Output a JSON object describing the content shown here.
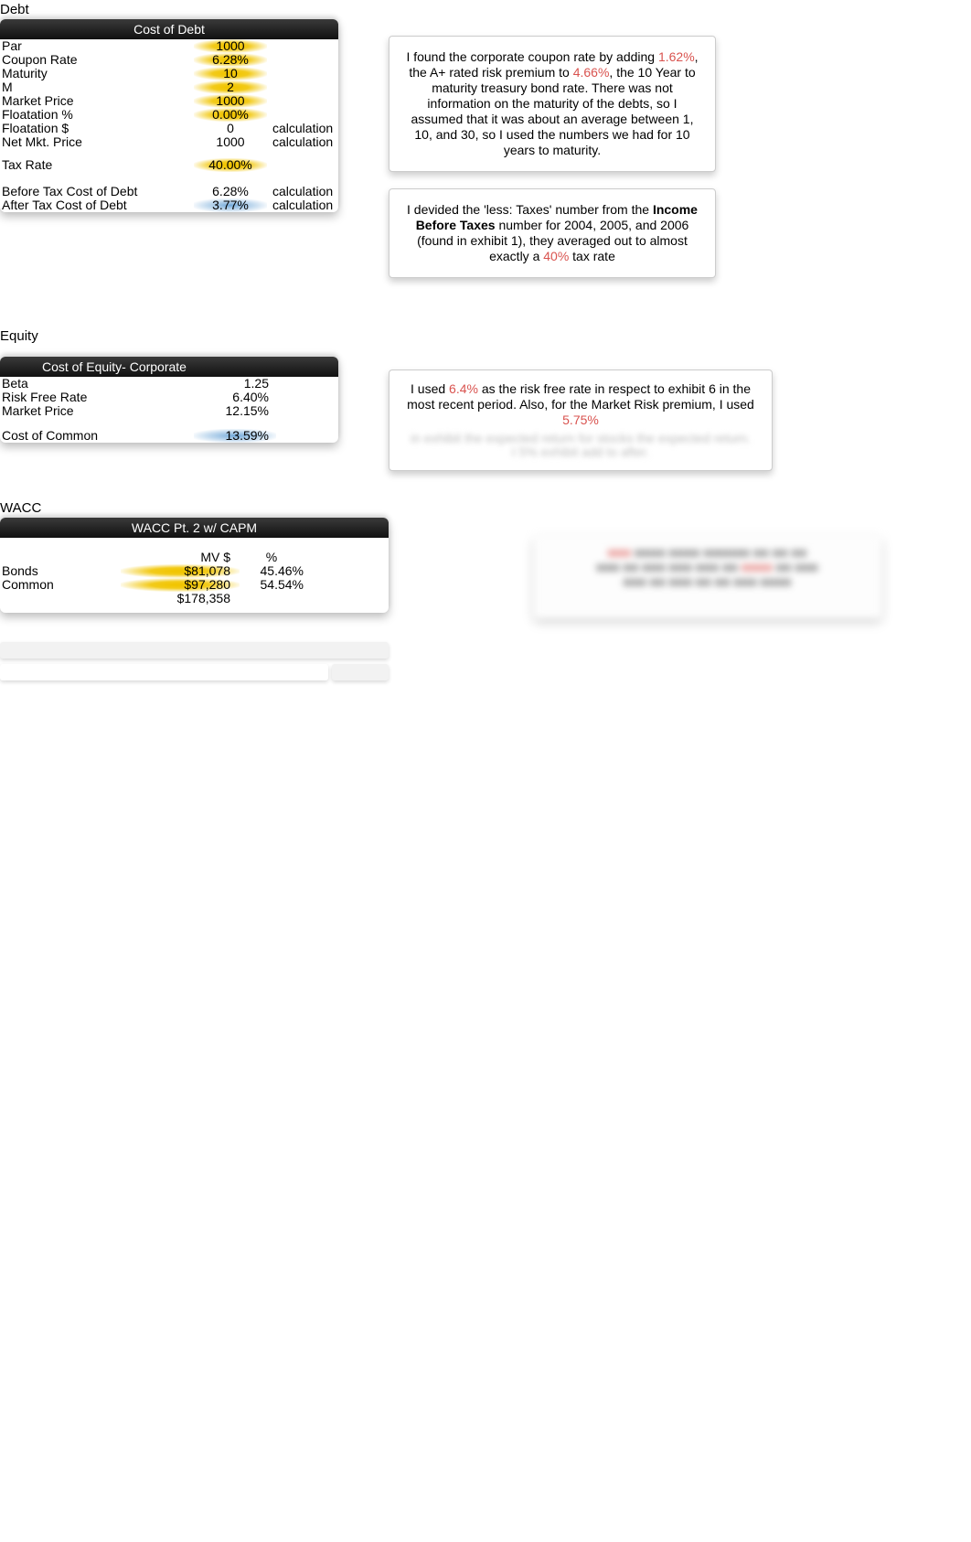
{
  "debt": {
    "section_label": "Debt",
    "title": "Cost of Debt",
    "rows": [
      {
        "label": "Par",
        "value": "1000",
        "note": "",
        "hl": "y"
      },
      {
        "label": "Coupon Rate",
        "value": "6.28%",
        "note": "",
        "hl": "y"
      },
      {
        "label": "Maturity",
        "value": "10",
        "note": "",
        "hl": "y"
      },
      {
        "label": "M",
        "value": "2",
        "note": "",
        "hl": "y"
      },
      {
        "label": "Market Price",
        "value": "1000",
        "note": "",
        "hl": "y"
      },
      {
        "label": "Floatation %",
        "value": "0.00%",
        "note": "",
        "hl": "y"
      },
      {
        "label": "Floatation $",
        "value": "0",
        "note": "calculation",
        "hl": ""
      },
      {
        "label": "Net Mkt. Price",
        "value": "1000",
        "note": "calculation",
        "hl": ""
      }
    ],
    "tax_row": {
      "label": "Tax Rate",
      "value": "40.00%",
      "note": "",
      "hl": "y"
    },
    "result_rows": [
      {
        "label": "Before Tax Cost of Debt",
        "value": "6.28%",
        "note": "calculation",
        "hl": ""
      },
      {
        "label": "After Tax Cost of Debt",
        "value": "3.77%",
        "note": "calculation",
        "hl": "b"
      }
    ],
    "explain1": {
      "p1": "I found the corporate coupon rate by adding ",
      "r1": "1.62%",
      "p2": ", the A+ rated risk premium to ",
      "r2": "4.66%",
      "p3": ", the 10 Year to maturity treasury bond rate. There was not information on the maturity of the debts, so I assumed that it was about an average between 1, 10, and 30, so I used the numbers we had for 10 years to maturity."
    },
    "explain2": {
      "p1": "I devided the 'less: Taxes' number from the ",
      "b1": "Income Before Taxes",
      "p2": " number for 2004, 2005, and 2006 (found in exhibit 1), they averaged out to almost exactly a ",
      "r1": "40%",
      "p3": " tax rate"
    }
  },
  "equity": {
    "section_label": "Equity",
    "title": "Cost of Equity- Corporate",
    "rows": [
      {
        "label": "Beta",
        "value": "1.25"
      },
      {
        "label": "Risk Free Rate",
        "value": "6.40%"
      },
      {
        "label": "Market Price",
        "value": "12.15%"
      }
    ],
    "result_row": {
      "label": "Cost of Common",
      "value": "13.59%",
      "hl": "b"
    },
    "explain": {
      "p1": "I used ",
      "r1": "6.4%",
      "p2": " as the risk free rate in respect to exhibit 6 in the most recent period. Also, for the Market Risk premium, I used ",
      "r2": "5.75%"
    }
  },
  "wacc": {
    "section_label": "WACC",
    "title": "WACC Pt. 2 w/ CAPM",
    "head_mv": "MV $",
    "head_pc": "%",
    "rows": [
      {
        "label": "Bonds",
        "mv": "$81,078",
        "pc": "45.46%",
        "hl": "y"
      },
      {
        "label": "Common",
        "mv": "$97,280",
        "pc": "54.54%",
        "hl": "y"
      },
      {
        "label": "",
        "mv": "$178,358",
        "pc": "",
        "hl": ""
      }
    ]
  }
}
